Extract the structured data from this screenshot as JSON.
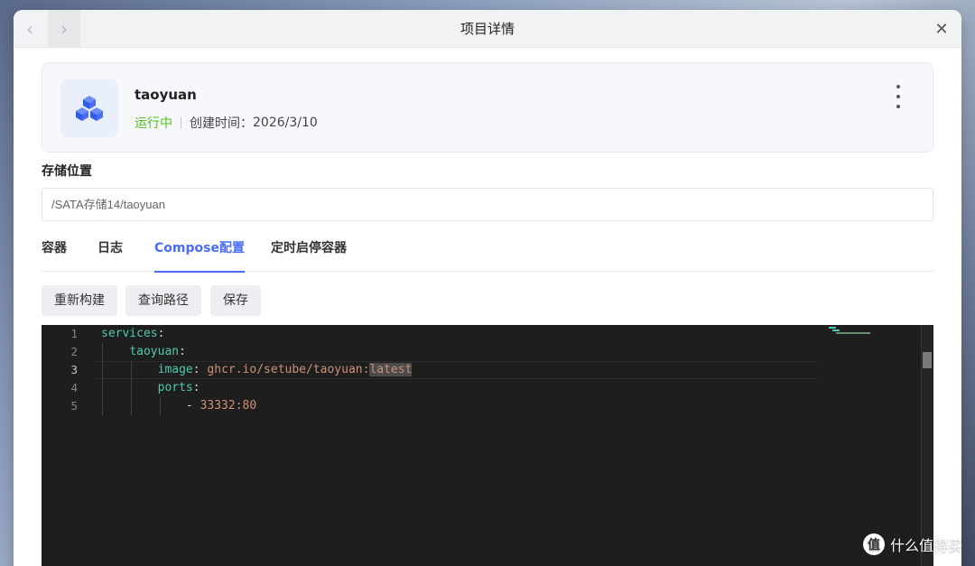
{
  "window": {
    "title": "项目详情"
  },
  "project": {
    "name": "taoyuan",
    "status": "运行中",
    "created_label": "创建时间：",
    "created_date": "2026/3/10"
  },
  "storage": {
    "label": "存储位置",
    "path": "/SATA存储14/taoyuan"
  },
  "tabs": [
    {
      "label": "容器",
      "active": false
    },
    {
      "label": "日志",
      "active": false
    },
    {
      "label": "Compose配置",
      "active": true
    },
    {
      "label": "定时启停容器",
      "active": false
    }
  ],
  "actions": {
    "rebuild": "重新构建",
    "query_path": "查询路径",
    "save": "保存"
  },
  "editor": {
    "line_numbers": [
      "1",
      "2",
      "3",
      "4",
      "5"
    ],
    "current_line": 3,
    "lines": [
      {
        "key": "services",
        "punct": ":",
        "value": ""
      },
      {
        "key": "taoyuan",
        "punct": ":",
        "value": ""
      },
      {
        "key": "image",
        "punct": ":",
        "value": "ghcr.io/setube/taoyuan:",
        "highlight": "latest"
      },
      {
        "key": "ports",
        "punct": ":",
        "value": ""
      },
      {
        "key": "",
        "punct": "- ",
        "value": "33332:80"
      }
    ]
  },
  "watermark": {
    "logo": "值",
    "text": "什么值得买"
  },
  "colors": {
    "accent": "#4a6cf7",
    "status_running": "#52c41a",
    "editor_bg": "#1e1e1e",
    "yaml_key": "#4ec9b0",
    "yaml_string": "#ce9178"
  },
  "icons": {
    "back": "chevron-left-icon",
    "forward": "chevron-right-icon",
    "close": "close-icon",
    "app": "cubes-icon",
    "more": "more-vertical-icon"
  }
}
